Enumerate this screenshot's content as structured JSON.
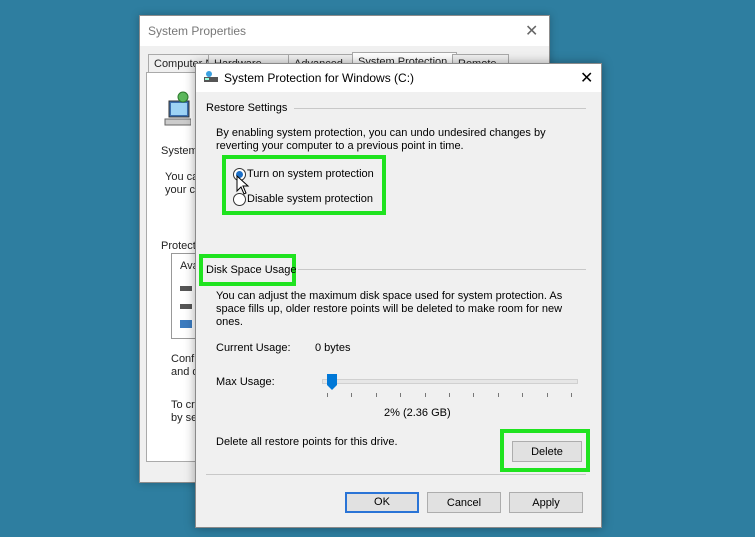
{
  "back_window": {
    "title": "System Properties",
    "tabs": [
      "Computer N",
      "Hardware",
      "Advanced",
      "System Protection",
      "Remote"
    ],
    "fragments": {
      "system": "System",
      "you_can": "You ca",
      "your_co": "your co",
      "protect": "Protecti",
      "ava": "Ava",
      "confi": "Confi",
      "and": "and d",
      "to_cr": "To cr",
      "by_se": "by se"
    }
  },
  "dialog": {
    "title": "System Protection for Windows (C:)",
    "restore_settings": {
      "label": "Restore Settings",
      "description_line1": "By enabling system protection, you can undo undesired changes by",
      "description_line2": "reverting your computer to a previous point in time.",
      "options": [
        "Turn on system protection",
        "Disable system protection"
      ],
      "selected": "Turn on system protection"
    },
    "disk_space": {
      "label": "Disk Space Usage",
      "description_line1": "You can adjust the maximum disk space used for system protection. As",
      "description_line2": "space fills up, older restore points will be deleted to make room for new",
      "description_line3": "ones.",
      "current_usage_label": "Current Usage:",
      "current_usage_value": "0 bytes",
      "max_usage_label": "Max Usage:",
      "max_usage_value": "2% (2.36 GB)",
      "slider_fraction": 0.02,
      "delete_text": "Delete all restore points for this drive.",
      "delete_button": "Delete"
    },
    "buttons": {
      "ok": "OK",
      "cancel": "Cancel",
      "apply": "Apply"
    }
  },
  "colors": {
    "highlight": "#1fe31f",
    "desktop": "#2e7ea0",
    "accent": "#2a74d6"
  }
}
